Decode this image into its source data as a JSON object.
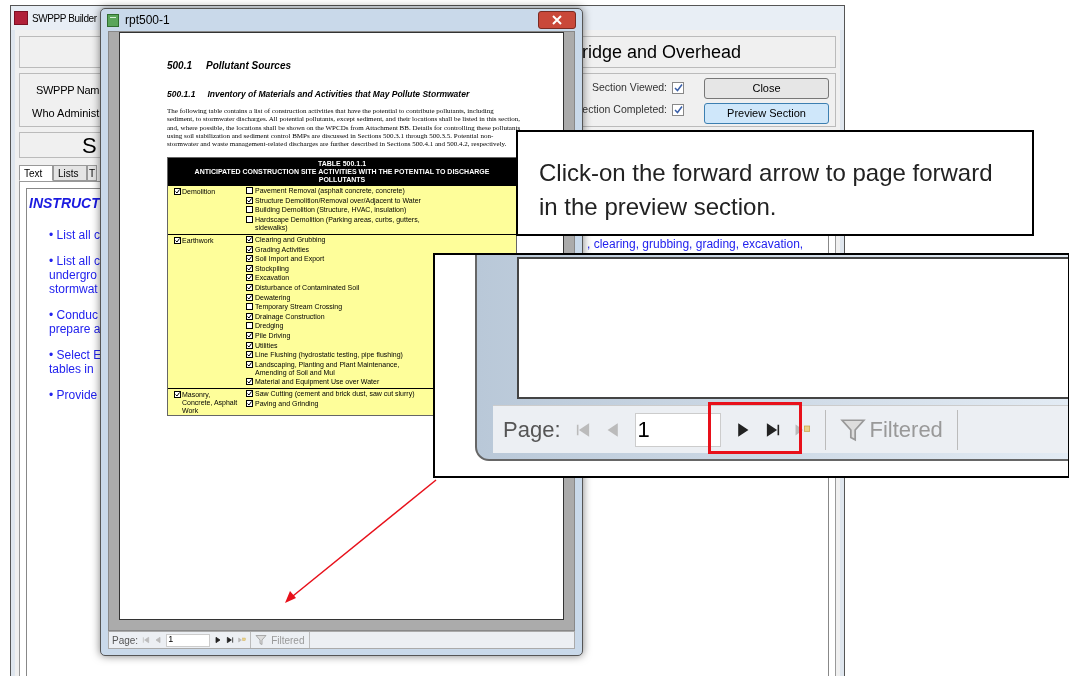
{
  "background_window": {
    "title": "SWPPP Builder",
    "header": "ridge and Overhead",
    "labels": [
      "SWPPP Nam",
      "Who Administ"
    ],
    "section_heading": "S",
    "tabs": [
      {
        "label": "Text",
        "selected": true
      },
      {
        "label": "Lists",
        "selected": false
      },
      {
        "label": "T",
        "selected": false
      }
    ],
    "instructions_title": "INSTRUCT",
    "bullets": [
      "• List all c",
      "• List all c\nundergro\nstormwat",
      "• Conduc\nprepare a",
      "• Select E\ntables in",
      "• Provide"
    ],
    "checks": [
      {
        "label": "Section Viewed:",
        "checked": true
      },
      {
        "label": "ection Completed:",
        "checked": true
      }
    ],
    "buttons": [
      {
        "label": "Close",
        "selected": false
      },
      {
        "label": "Preview Section",
        "selected": true
      }
    ],
    "text_fragment": ", clearing, grubbing, grading, excavation,"
  },
  "report_window": {
    "title": "rpt500-1",
    "section_number": "500.1",
    "section_title": "Pollutant Sources",
    "subsection_number": "500.1.1",
    "subsection_title": "Inventory of Materials and Activities that May Pollute Stormwater",
    "paragraph": "The following table contains a list of construction activities that have the potential to contribute pollutants, including sediment, to stormwater discharges. All potential pollutants, except sediment, and their locations shall be listed in this section, and, where possible, the locations shall be shown on the WPCDs from Attachment BB. Details for controlling these pollutants using soil stabilization and sediment control BMPs are discussed in Sections 500.3.1 through 500.3.5. Potential non-stormwater and waste management-related discharges are further described in Sections 500.4.1 and 500.4.2, respectively.",
    "table_title": "TABLE 500.1.1",
    "table_subtitle": "ANTICIPATED CONSTRUCTION SITE ACTIVITIES WITH THE POTENTIAL TO DISCHARGE POLLUTANTS",
    "categories": [
      {
        "label": "Demolition",
        "checked": true,
        "items": [
          {
            "label": "Pavement Removal (asphalt concrete, concrete)",
            "checked": false
          },
          {
            "label": "Structure Demolition/Removal over/Adjacent to Water",
            "checked": true
          },
          {
            "label": "Building Demolition (Structure, HVAC, insulation)",
            "checked": false
          },
          {
            "label": "Hardscape Demolition (Parking areas, curbs, gutters, sidewalks)",
            "checked": false
          }
        ]
      },
      {
        "label": "Earthwork",
        "checked": true,
        "items": [
          {
            "label": "Clearing and Grubbing",
            "checked": true
          },
          {
            "label": "Grading Activities",
            "checked": true
          },
          {
            "label": "Soil Import and Export",
            "checked": true
          },
          {
            "label": "Stockpiling",
            "checked": true
          },
          {
            "label": "Excavation",
            "checked": true
          },
          {
            "label": "Disturbance of Contaminated Soil",
            "checked": true
          },
          {
            "label": "Dewatering",
            "checked": true
          },
          {
            "label": "Temporary Stream Crossing",
            "checked": false
          },
          {
            "label": "Drainage Construction",
            "checked": true
          },
          {
            "label": "Dredging",
            "checked": false
          },
          {
            "label": "Pile Driving",
            "checked": true
          },
          {
            "label": "Utilities",
            "checked": true
          },
          {
            "label": "Line Flushing (hydrostatic testing, pipe flushing)",
            "checked": true
          },
          {
            "label": "Landscaping, Planting and Plant Maintenance, Amending of Soil and Mul",
            "checked": true
          },
          {
            "label": "Material and Equipment Use over Water",
            "checked": true
          }
        ]
      },
      {
        "label": "Masonry, Concrete, Asphalt Work",
        "checked": true,
        "items": [
          {
            "label": "Saw Cutting (cement and brick dust, saw cut slurry)",
            "checked": true
          },
          {
            "label": "Paving and Grinding",
            "checked": true
          }
        ]
      }
    ],
    "nav": {
      "label": "Page:",
      "page": "1",
      "filter_label": "Filtered",
      "buttons": [
        {
          "kind": "first",
          "disabled": true
        },
        {
          "kind": "previous",
          "disabled": true
        },
        {
          "kind": "next",
          "disabled": false
        },
        {
          "kind": "last",
          "disabled": false
        },
        {
          "kind": "new",
          "disabled": true
        }
      ]
    }
  },
  "callout": {
    "text": "Click-on the forward arrow to page forward in the preview section."
  },
  "zoom_callout": {
    "label": "Page:",
    "page": "1",
    "filter_label": "Filtered",
    "buttons": [
      {
        "kind": "first",
        "disabled": true
      },
      {
        "kind": "previous",
        "disabled": true
      },
      {
        "kind": "next",
        "disabled": false
      },
      {
        "kind": "last",
        "disabled": false
      },
      {
        "kind": "new",
        "disabled": true
      }
    ]
  }
}
